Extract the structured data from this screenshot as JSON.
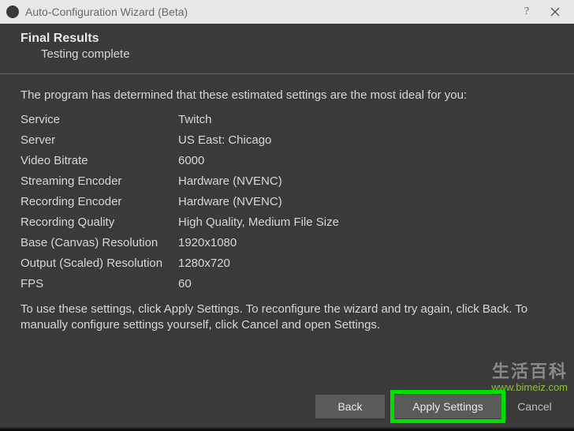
{
  "window": {
    "title": "Auto-Configuration Wizard (Beta)"
  },
  "header": {
    "title": "Final Results",
    "subtitle": "Testing complete"
  },
  "content": {
    "intro": "The program has determined that these estimated settings are the most ideal for you:",
    "settings": [
      {
        "label": "Service",
        "value": "Twitch"
      },
      {
        "label": "Server",
        "value": "US East: Chicago"
      },
      {
        "label": "Video Bitrate",
        "value": "6000"
      },
      {
        "label": "Streaming Encoder",
        "value": "Hardware (NVENC)"
      },
      {
        "label": "Recording Encoder",
        "value": "Hardware (NVENC)"
      },
      {
        "label": "Recording Quality",
        "value": "High Quality, Medium File Size"
      },
      {
        "label": "Base (Canvas) Resolution",
        "value": "1920x1080"
      },
      {
        "label": "Output (Scaled) Resolution",
        "value": "1280x720"
      },
      {
        "label": "FPS",
        "value": "60"
      }
    ],
    "instructions": "To use these settings, click Apply Settings.  To reconfigure the wizard and try again, click Back.  To manually configure settings yourself, click Cancel and open Settings."
  },
  "footer": {
    "back": "Back",
    "apply": "Apply Settings",
    "cancel": "Cancel"
  },
  "watermark": {
    "text": "生活百科",
    "url": "www.bimeiz.com"
  }
}
